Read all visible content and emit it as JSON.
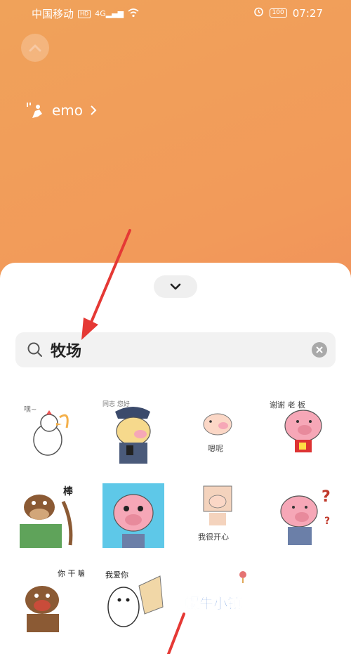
{
  "status_bar": {
    "carrier": "中国移动",
    "network_badge": "HD",
    "signal": "4G",
    "battery": "100",
    "time": "07:27"
  },
  "profile": {
    "name": "emo"
  },
  "search": {
    "query": "牧场"
  },
  "stickers": [
    {
      "icon": "chicken-sticker-icon",
      "caption": "嘿~"
    },
    {
      "icon": "police-pig-sticker-icon",
      "caption": "同志 您好"
    },
    {
      "icon": "small-pig-sticker-icon",
      "caption": "嗯呢"
    },
    {
      "icon": "pig-boss-sticker-icon",
      "caption": "谢谢 老 板"
    },
    {
      "icon": "horse-sticker-icon",
      "caption": "棒"
    },
    {
      "icon": "pig-blue-bg-sticker-icon",
      "caption": ""
    },
    {
      "icon": "pig-happy-sticker-icon",
      "caption": "我很开心"
    },
    {
      "icon": "pig-question-sticker-icon",
      "caption": ""
    },
    {
      "icon": "dog-sticker-icon",
      "caption": "你 干 嘛"
    },
    {
      "icon": "love-you-sticker-icon",
      "caption": "我爱你"
    },
    {
      "icon": "snail-town-logo-icon",
      "caption": "蜗牛小镇"
    }
  ],
  "colors": {
    "background_top": "#f0a25a",
    "background_bottom": "#ec7f5a",
    "annotation_arrow": "#e53935",
    "pig_pink": "#f6a7b7"
  }
}
